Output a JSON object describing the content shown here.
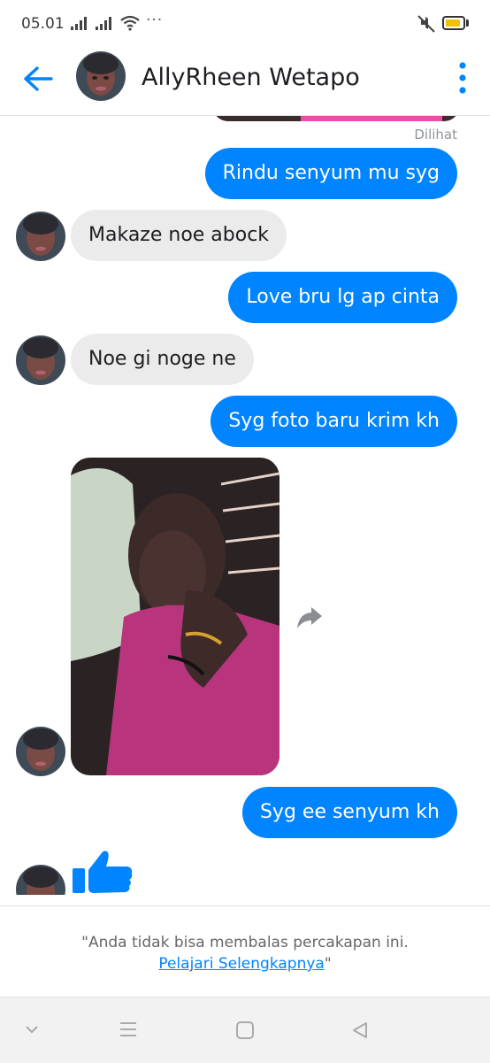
{
  "status_bar": {
    "time": "05.01",
    "more": "···"
  },
  "header": {
    "contact_name": "AllyRheen Wetapo"
  },
  "conversation": {
    "seen_label": "Dilihat",
    "messages": [
      {
        "text": "Rindu senyum mu syg"
      },
      {
        "text": "Makaze noe abock"
      },
      {
        "text": "Love bru lg ap cinta"
      },
      {
        "text": "Noe gi noge ne"
      },
      {
        "text": "Syg foto baru krim kh"
      },
      {
        "text": "Syg ee senyum kh"
      }
    ]
  },
  "footer": {
    "notice": "\"Anda tidak bisa membalas percakapan ini.",
    "link": "Pelajari Selengkapnya",
    "link_suffix": "\""
  },
  "colors": {
    "accent": "#0084ff",
    "incoming_bubble": "#ebebeb",
    "battery": "#f2c200"
  },
  "icons": [
    "back-arrow-icon",
    "more-vertical-icon",
    "share-icon",
    "thumbs-up-icon",
    "signal-icon",
    "wifi-icon",
    "mute-icon",
    "battery-icon"
  ]
}
